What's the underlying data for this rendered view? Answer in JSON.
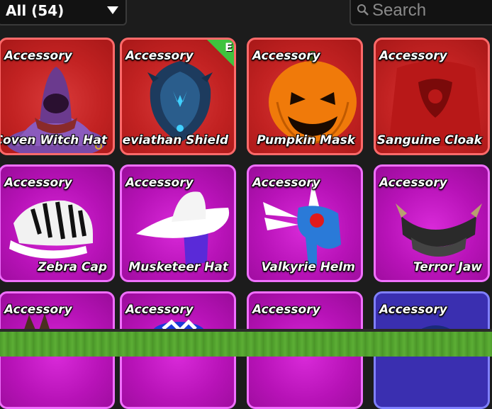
{
  "filter": {
    "label": "All (54)"
  },
  "search": {
    "placeholder": "Search"
  },
  "items": [
    {
      "category": "Accessory",
      "name": "Coven Witch Hat",
      "rarity": "red"
    },
    {
      "category": "Accessory",
      "name": "Leviathan Shield",
      "rarity": "red",
      "equipped_badge": "E"
    },
    {
      "category": "Accessory",
      "name": "Pumpkin Mask",
      "rarity": "red"
    },
    {
      "category": "Accessory",
      "name": "Sanguine Cloak",
      "rarity": "red"
    },
    {
      "category": "Accessory",
      "name": "Zebra Cap",
      "rarity": "purple"
    },
    {
      "category": "Accessory",
      "name": "Musketeer Hat",
      "rarity": "purple"
    },
    {
      "category": "Accessory",
      "name": "Valkyrie Helm",
      "rarity": "purple"
    },
    {
      "category": "Accessory",
      "name": "Terror Jaw",
      "rarity": "purple"
    },
    {
      "category": "Accessory",
      "name": "",
      "rarity": "purple"
    },
    {
      "category": "Accessory",
      "name": "",
      "rarity": "purple"
    },
    {
      "category": "Accessory",
      "name": "",
      "rarity": "purple"
    },
    {
      "category": "Accessory",
      "name": "",
      "rarity": "blue"
    }
  ],
  "colors": {
    "red_rarity": "#c22222",
    "purple_rarity": "#b712b7",
    "blue_rarity": "#3a2fb0",
    "equipped": "#3ec33e"
  }
}
